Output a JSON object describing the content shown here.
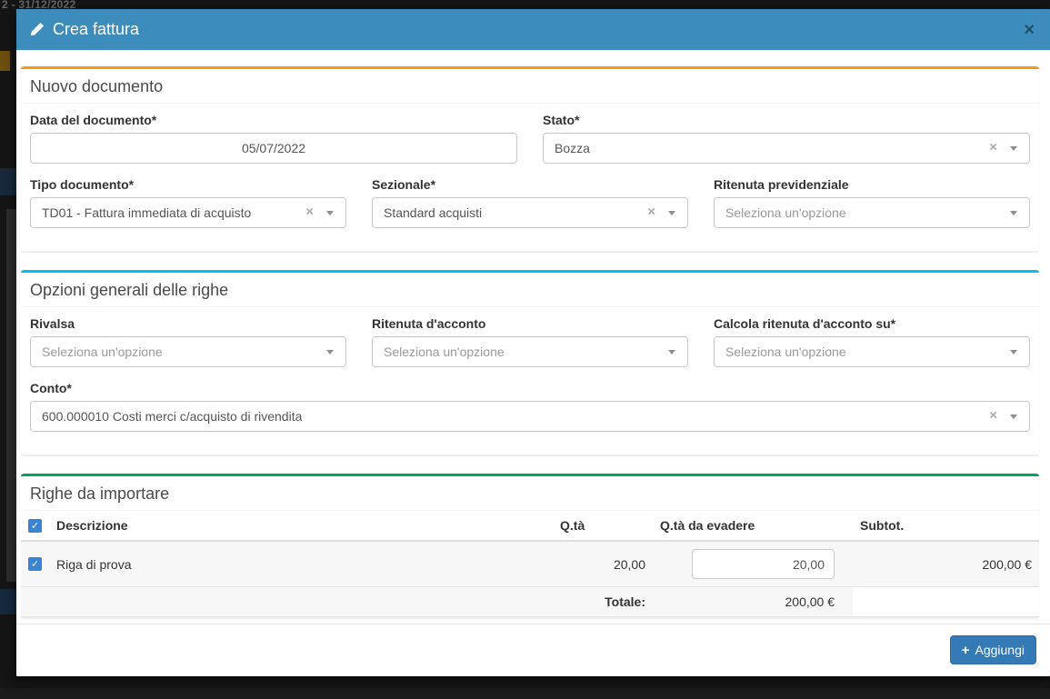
{
  "background": {
    "top_text": "2 - 31/12/2022"
  },
  "glyphs": {
    "close": "×",
    "clear": "×",
    "check": "✓",
    "plus": "+"
  },
  "colors": {
    "header_bg": "#3c8dbc",
    "box_documento_accent": "#f39c12",
    "box_opzioni_accent": "#00c0ef",
    "box_righe_accent": "#00a65a",
    "button_bg": "#337ab7",
    "checkbox_bg": "#3b83d4"
  },
  "modal": {
    "title": "Crea fattura"
  },
  "sections": {
    "nuovo_documento": {
      "title": "Nuovo documento",
      "fields": {
        "data_documento": {
          "label": "Data del documento*",
          "value": "05/07/2022"
        },
        "stato": {
          "label": "Stato*",
          "value": "Bozza"
        },
        "tipo_documento": {
          "label": "Tipo documento*",
          "value": "TD01 - Fattura immediata di acquisto"
        },
        "sezionale": {
          "label": "Sezionale*",
          "value": "Standard acquisti"
        },
        "ritenuta_previdenziale": {
          "label": "Ritenuta previdenziale",
          "placeholder": "Seleziona un'opzione"
        }
      }
    },
    "opzioni_generali": {
      "title": "Opzioni generali delle righe",
      "fields": {
        "rivalsa": {
          "label": "Rivalsa",
          "placeholder": "Seleziona un'opzione"
        },
        "ritenuta_acconto": {
          "label": "Ritenuta d'acconto",
          "placeholder": "Seleziona un'opzione"
        },
        "calcola_ritenuta": {
          "label": "Calcola ritenuta d'acconto su*",
          "placeholder": "Seleziona un'opzione"
        },
        "conto": {
          "label": "Conto*",
          "value": "600.000010 Costi merci c/acquisto di rivendita"
        }
      }
    },
    "righe_da_importare": {
      "title": "Righe da importare",
      "table": {
        "headers": {
          "descrizione": "Descrizione",
          "qta": "Q.tà",
          "qta_da_evadere": "Q.tà da evadere",
          "subtot": "Subtot."
        },
        "rows": [
          {
            "checked": true,
            "descrizione": "Riga di prova",
            "qta": "20,00",
            "qta_da_evadere": "20,00",
            "subtot": "200,00 €"
          }
        ],
        "totale_label": "Totale:",
        "totale_value": "200,00 €"
      }
    }
  },
  "footer": {
    "add_button_label": "Aggiungi"
  }
}
